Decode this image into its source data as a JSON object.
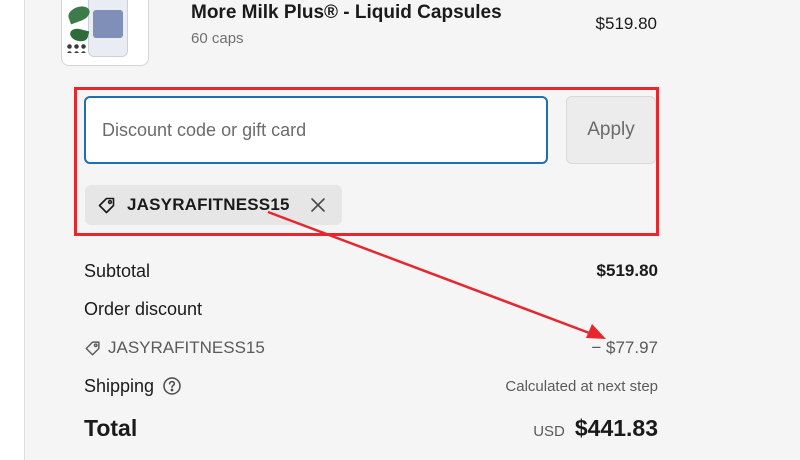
{
  "product": {
    "name": "More Milk Plus® - Liquid Capsules",
    "variant": "60 caps",
    "price": "$519.80",
    "image_icon": "supplement-bottle-image"
  },
  "discount": {
    "placeholder": "Discount code or gift card",
    "value": "",
    "apply_label": "Apply",
    "applied_code": "JASYRAFITNESS15",
    "tag_icon": "tag-icon",
    "remove_icon": "close-icon"
  },
  "summary": {
    "subtotal_label": "Subtotal",
    "subtotal_value": "$519.80",
    "order_discount_label": "Order discount",
    "discount_code": "JASYRAFITNESS15",
    "discount_amount": "− $77.97",
    "shipping_label": "Shipping",
    "shipping_value": "Calculated at next step",
    "total_label": "Total",
    "currency": "USD",
    "total_value": "$441.83"
  },
  "annotation": {
    "box_color": "#e8262d",
    "arrow_color": "#e8262d"
  },
  "colors": {
    "input_border": "#1f6fb2",
    "panel_bg": "#f5f5f5"
  }
}
